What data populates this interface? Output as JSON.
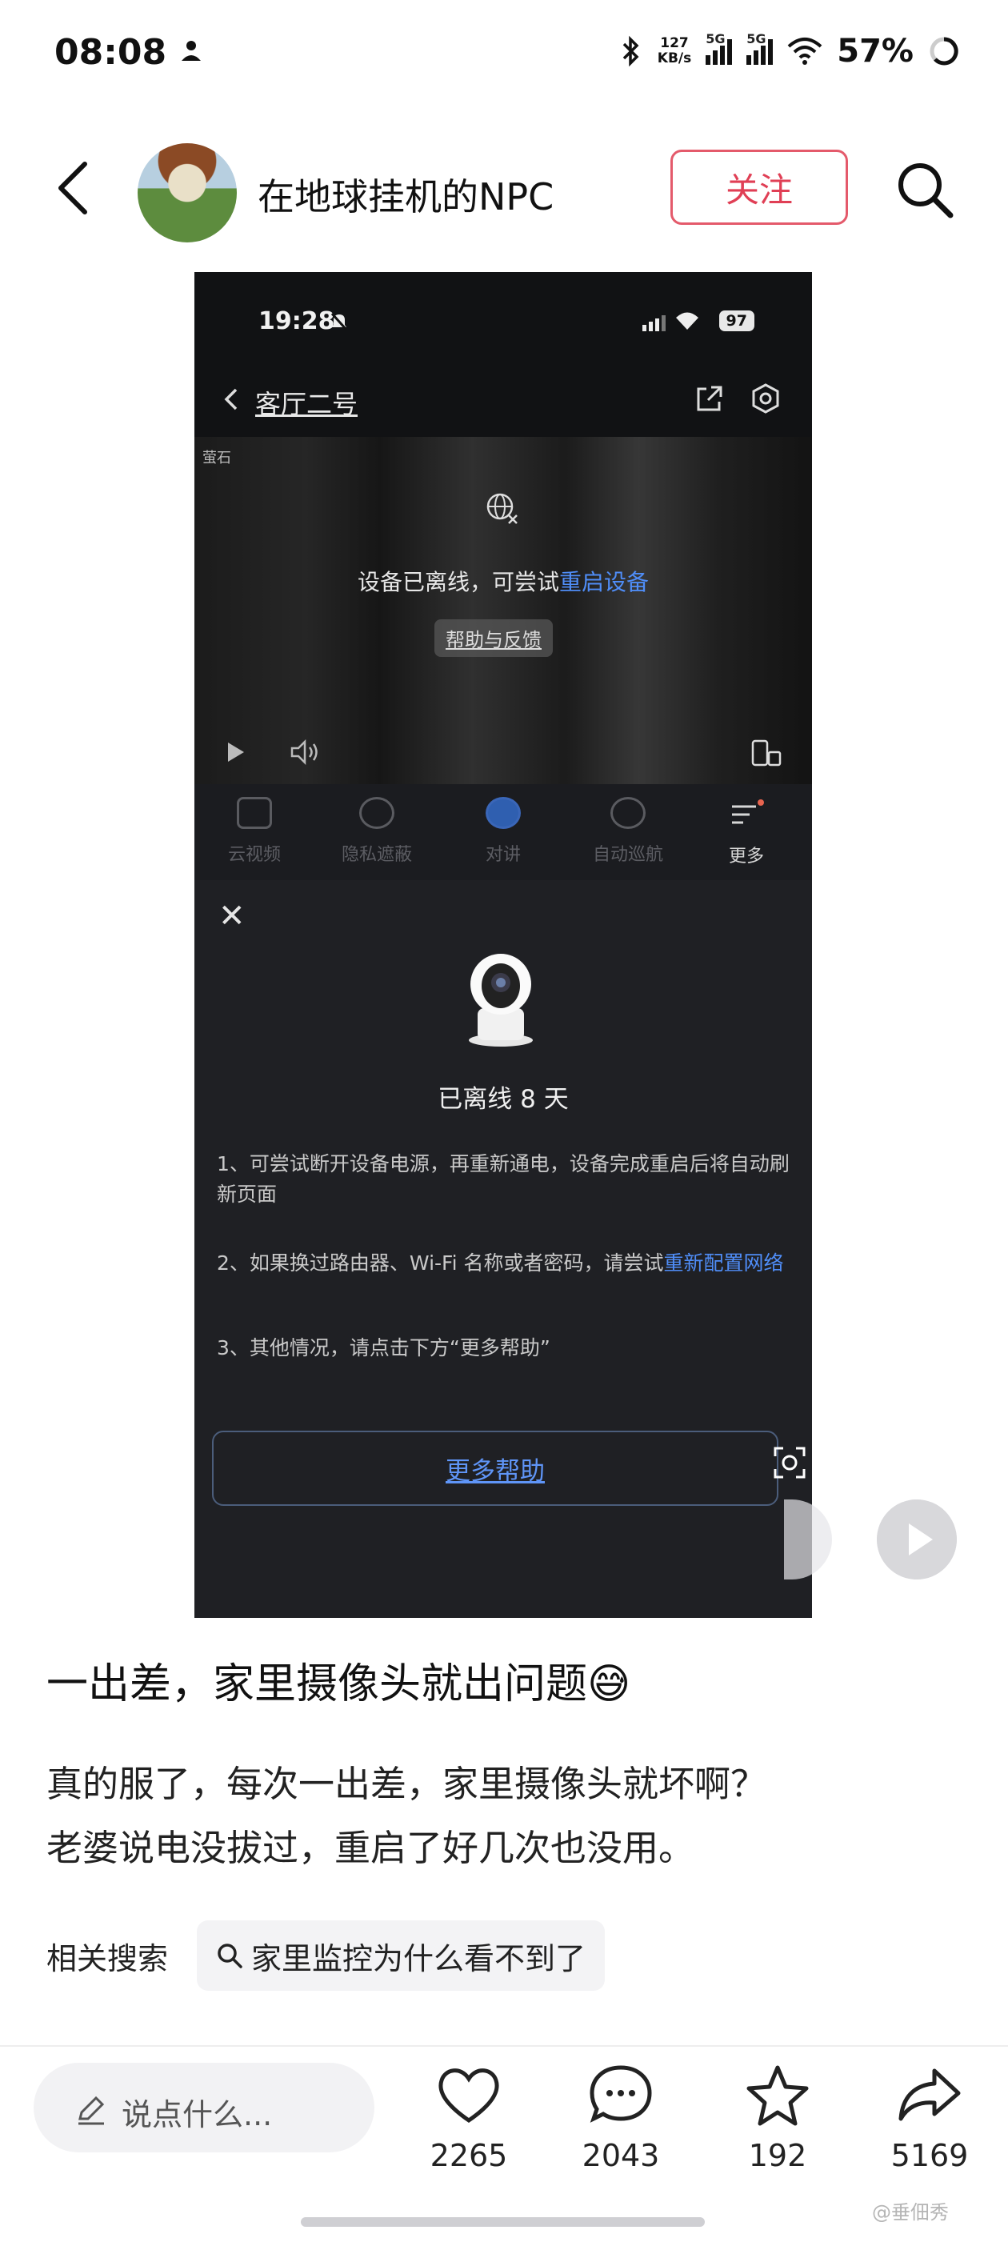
{
  "status_bar": {
    "time": "08:08",
    "net_speed_value": "127",
    "net_speed_unit": "KB/s",
    "signal1_tag": "5G",
    "signal2_tag": "5G",
    "battery": "57%"
  },
  "header": {
    "author_name": "在地球挂机的NPC",
    "follow_label": "关注"
  },
  "embedded_screenshot": {
    "time": "19:28",
    "battery": "97",
    "device_title": "客厅二号",
    "video_logo": "萤石",
    "offline_message": "设备已离线，可尝试",
    "restart_link": "重启设备",
    "help_feedback": "帮助与反馈",
    "toolbar": [
      {
        "label": "云视频"
      },
      {
        "label": "隐私遮蔽"
      },
      {
        "label": "对讲"
      },
      {
        "label": "自动巡航"
      },
      {
        "label": "更多"
      }
    ],
    "panel": {
      "title": "已离线 8 天",
      "step1": "1、可尝试断开设备电源，再重新通电，设备完成重启后将自动刷新页面",
      "step2_text": "2、如果换过路由器、Wi-Fi 名称或者密码，请尝试",
      "step2_link": "重新配置网络",
      "step3": "3、其他情况，请点击下方“更多帮助”",
      "more_help": "更多帮助"
    }
  },
  "post": {
    "title": "一出差，家里摄像头就出问题😅",
    "body_line1": "真的服了，每次一出差，家里摄像头就坏啊？",
    "body_line2": "老婆说电没拔过，重启了好几次也没用。",
    "related_label": "相关搜索",
    "related_query": "家里监控为什么看不到了"
  },
  "bottom_bar": {
    "comment_placeholder": "说点什么...",
    "likes": "2265",
    "comments": "2043",
    "favorites": "192",
    "shares": "5169"
  },
  "watermark": "@垂佃秀"
}
